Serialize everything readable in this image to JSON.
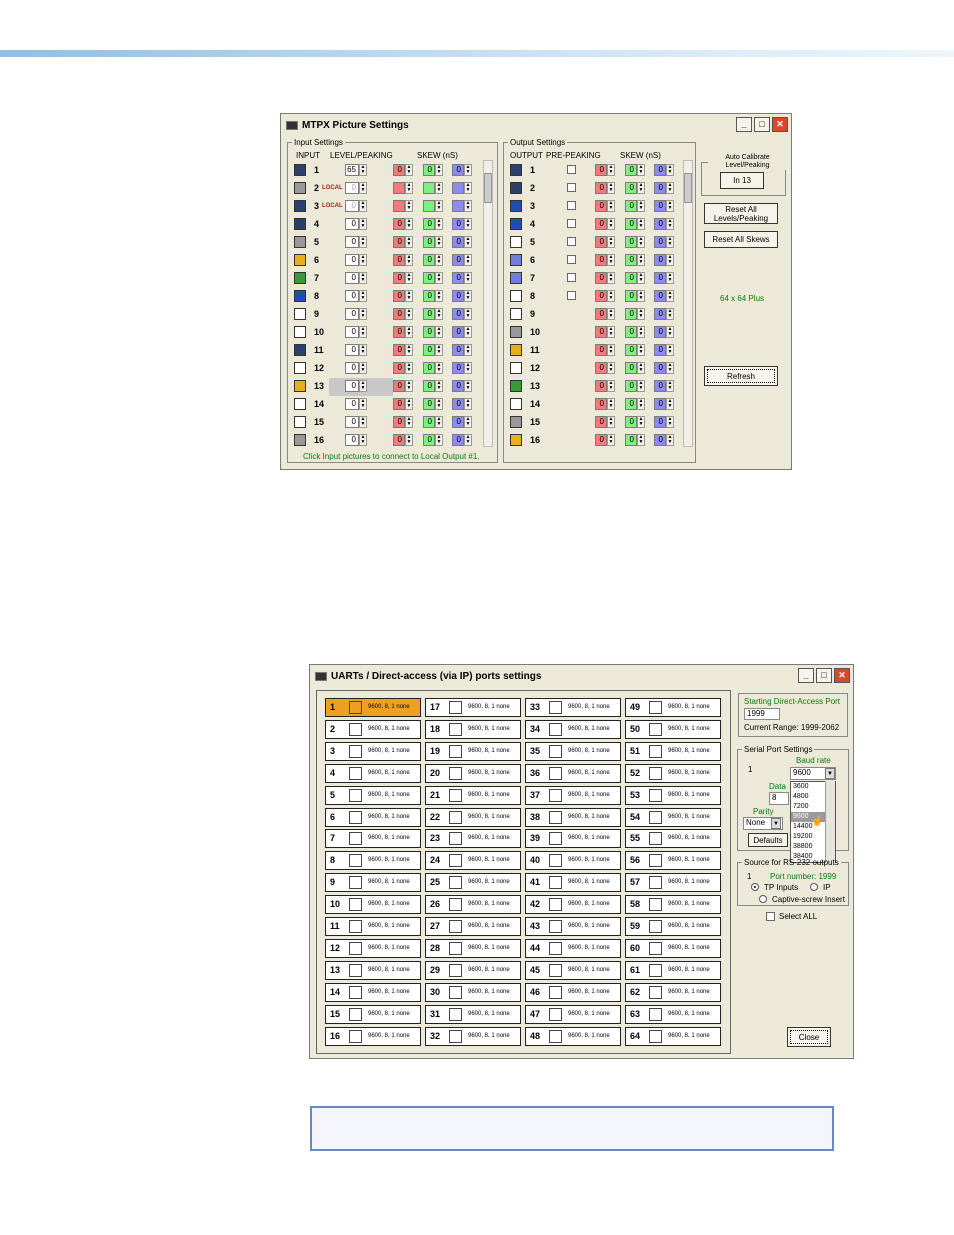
{
  "mtpx": {
    "title": "MTPX Picture Settings",
    "input_group": "Input Settings",
    "output_group": "Output Settings",
    "col_input": "INPUT",
    "col_level": "LEVEL/PEAKING",
    "col_skew": "SKEW (nS)",
    "col_output": "OUTPUT",
    "col_prepeak": "PRE-PEAKING",
    "local_label": "LOCAL",
    "inputs": [
      {
        "n": "1",
        "level": "65",
        "local": false,
        "icon": "computer-icon"
      },
      {
        "n": "2",
        "level": "0",
        "local": true,
        "icon": "laptop-icon"
      },
      {
        "n": "3",
        "level": "0",
        "local": true,
        "icon": "video-icon"
      },
      {
        "n": "4",
        "level": "0",
        "local": false,
        "icon": "monitor-icon"
      },
      {
        "n": "5",
        "level": "0",
        "local": false,
        "icon": "camera-icon"
      },
      {
        "n": "6",
        "level": "0",
        "local": false,
        "icon": "chart-icon"
      },
      {
        "n": "7",
        "level": "0",
        "local": false,
        "icon": "globe-icon"
      },
      {
        "n": "8",
        "level": "0",
        "local": false,
        "icon": "envelope-icon"
      },
      {
        "n": "9",
        "level": "0",
        "local": false,
        "icon": "blank-icon"
      },
      {
        "n": "10",
        "level": "0",
        "local": false,
        "icon": "mouse-icon"
      },
      {
        "n": "11",
        "level": "0",
        "local": false,
        "icon": "projector-icon"
      },
      {
        "n": "12",
        "level": "0",
        "local": false,
        "icon": "blank-icon"
      },
      {
        "n": "13",
        "level": "0",
        "local": false,
        "icon": "phone-icon"
      },
      {
        "n": "14",
        "level": "0",
        "local": false,
        "icon": "blank-icon"
      },
      {
        "n": "15",
        "level": "0",
        "local": false,
        "icon": "blank-icon"
      },
      {
        "n": "16",
        "level": "0",
        "local": false,
        "icon": "camera-icon"
      }
    ],
    "outputs": [
      "1",
      "2",
      "3",
      "4",
      "5",
      "6",
      "7",
      "8",
      "9",
      "10",
      "11",
      "12",
      "13",
      "14",
      "15",
      "16"
    ],
    "skew_value": "0",
    "auto_calibrate_label": "Auto Calibrate Level/Peaking",
    "in_button": "In 13",
    "reset_levels": "Reset All Levels/Peaking",
    "reset_skews": "Reset All Skews",
    "model": "64 x 64 Plus",
    "refresh": "Refresh",
    "footer_note": "Click Input pictures to connect to Local Output #1."
  },
  "uarts": {
    "title": "UARTs / Direct-access (via IP) ports settings",
    "port_setting": "9600, 8, 1 none",
    "ports": [
      "1",
      "2",
      "3",
      "4",
      "5",
      "6",
      "7",
      "8",
      "9",
      "10",
      "11",
      "12",
      "13",
      "14",
      "15",
      "16",
      "17",
      "18",
      "19",
      "20",
      "21",
      "22",
      "23",
      "24",
      "25",
      "26",
      "27",
      "28",
      "29",
      "30",
      "31",
      "32",
      "33",
      "34",
      "35",
      "36",
      "37",
      "38",
      "39",
      "40",
      "41",
      "42",
      "43",
      "44",
      "45",
      "46",
      "47",
      "48",
      "49",
      "50",
      "51",
      "52",
      "53",
      "54",
      "55",
      "56",
      "57",
      "58",
      "59",
      "60",
      "61",
      "62",
      "63",
      "64"
    ],
    "starting_port_label": "Starting Direct-Access Port",
    "starting_port_value": "1999",
    "current_range": "Current Range: 1999-2062",
    "serial_group": "Serial Port Settings",
    "serial_port_num": "1",
    "baud_label": "Baud rate",
    "baud_value": "9600",
    "baud_options": [
      "3600",
      "4800",
      "7200",
      "9600",
      "14400",
      "19200",
      "38800",
      "38400"
    ],
    "data_label": "Data",
    "data_value": "8",
    "parity_label": "Parity",
    "parity_value": "None",
    "defaults_button": "Defaults",
    "source_group": "Source for RS-232 outputs",
    "source_num": "1",
    "port_number": "Port number: 1999",
    "opt_tp": "TP Inputs",
    "opt_ip": "IP",
    "opt_captive": "Captive-screw Insert",
    "select_all": "Select ALL",
    "close": "Close"
  }
}
